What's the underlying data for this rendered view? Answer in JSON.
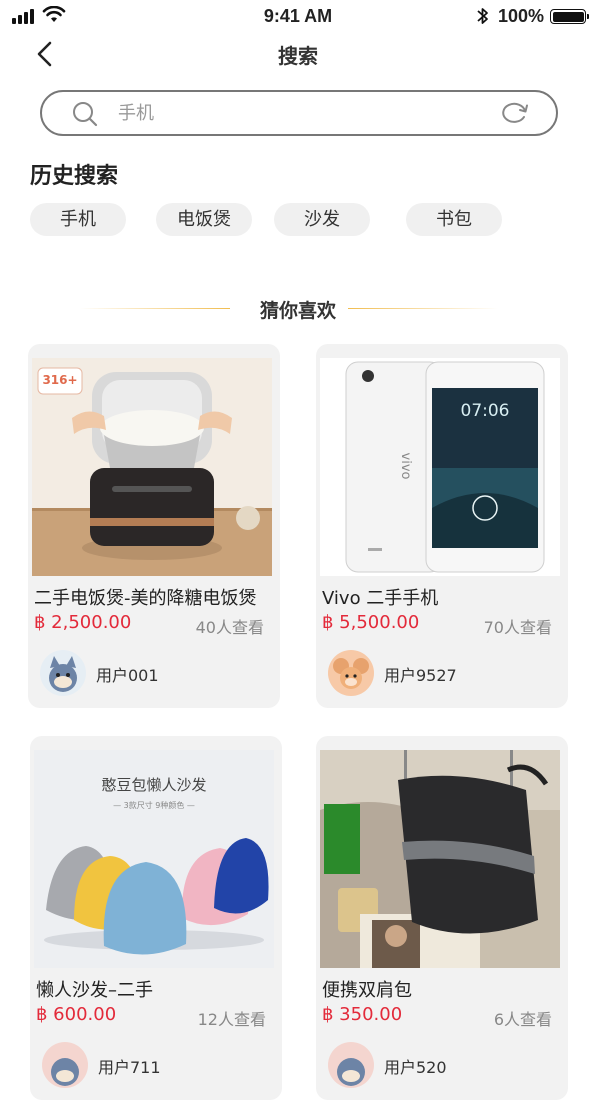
{
  "status_bar": {
    "time": "9:41 AM",
    "battery": "100%"
  },
  "nav": {
    "title": "搜索"
  },
  "search": {
    "placeholder": "手机"
  },
  "history": {
    "title": "历史搜索",
    "items": [
      "手机",
      "电饭煲",
      "沙发",
      "书包"
    ]
  },
  "recommend": {
    "title": "猜你喜欢",
    "products": [
      {
        "title": "二手电饭煲-美的降糖电饭煲",
        "price": "฿ 2,500.00",
        "views": "40人查看",
        "user": "用户001",
        "badge": "316+"
      },
      {
        "title": "Vivo 二手手机",
        "price": "฿ 5,500.00",
        "views": "70人查看",
        "user": "用户9527",
        "brand": "vivo",
        "clock": "07:06"
      },
      {
        "title": "懒人沙发–二手",
        "price": "฿ 600.00",
        "views": "12人查看",
        "user": "用户711",
        "banner_title": "憨豆包懒人沙发",
        "banner_sub": "— 3款尺寸  9种颜色 —"
      },
      {
        "title": "便携双肩包",
        "price": "฿ 350.00",
        "views": "6人查看",
        "user": "用户520"
      }
    ]
  },
  "colors": {
    "price": "#e32a3a",
    "accent_line": "#f1bd50",
    "card_bg": "#f2f2f2",
    "chip_bg": "#f0f0f0"
  }
}
